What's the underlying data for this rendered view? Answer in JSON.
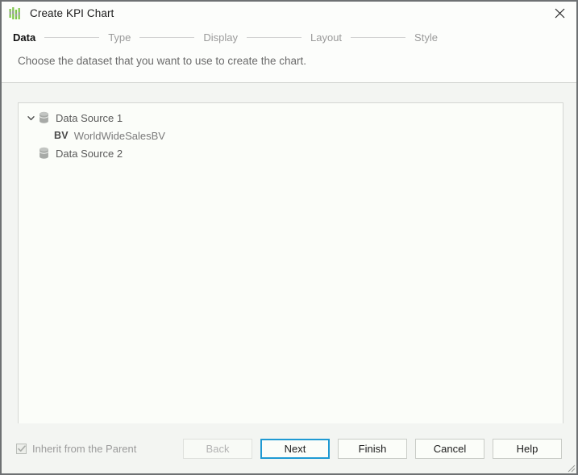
{
  "window": {
    "title": "Create KPI Chart",
    "app_icon": "kpi-chart-icon",
    "close_icon": "close-icon",
    "accent_color": "#1f9ad3",
    "border_color": "#6e7173",
    "content_bg": "#f3f5f2"
  },
  "steps": [
    {
      "label": "Data",
      "active": true
    },
    {
      "label": "Type",
      "active": false
    },
    {
      "label": "Display",
      "active": false
    },
    {
      "label": "Layout",
      "active": false
    },
    {
      "label": "Style",
      "active": false
    }
  ],
  "instruction": "Choose the dataset that you want to use to create the chart.",
  "tree": {
    "items": [
      {
        "label": "Data Source 1",
        "level": 0,
        "icon": "database-icon",
        "twisty": "chevron-down-icon",
        "expanded": true
      },
      {
        "label": "WorldWideSalesBV",
        "level": 1,
        "icon": "bv-icon",
        "icon_text": "BV",
        "twisty": "none",
        "expanded": false
      },
      {
        "label": "Data Source 2",
        "level": 0,
        "icon": "database-icon",
        "twisty": "none",
        "expanded": false
      }
    ]
  },
  "footer": {
    "inherit_label": "Inherit from the Parent",
    "inherit_checked": true,
    "inherit_enabled": false,
    "buttons": [
      {
        "label": "Back",
        "state": "disabled"
      },
      {
        "label": "Next",
        "state": "focused"
      },
      {
        "label": "Finish",
        "state": "normal"
      },
      {
        "label": "Cancel",
        "state": "normal"
      },
      {
        "label": "Help",
        "state": "normal"
      }
    ]
  }
}
